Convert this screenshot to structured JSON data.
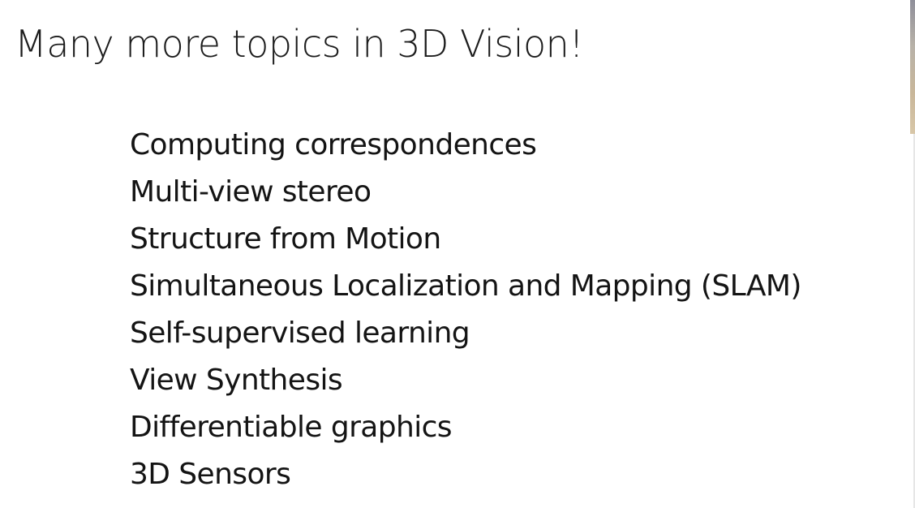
{
  "slide": {
    "title": "Many more topics in 3D Vision!",
    "topics": [
      "Computing correspondences",
      "Multi-view stereo",
      "Structure from Motion",
      "Simultaneous Localization and Mapping (SLAM)",
      "Self-supervised learning",
      "View Synthesis",
      "Differentiable graphics",
      "3D Sensors"
    ]
  },
  "colors": {
    "background": "#ffffff",
    "text": "#141414"
  }
}
